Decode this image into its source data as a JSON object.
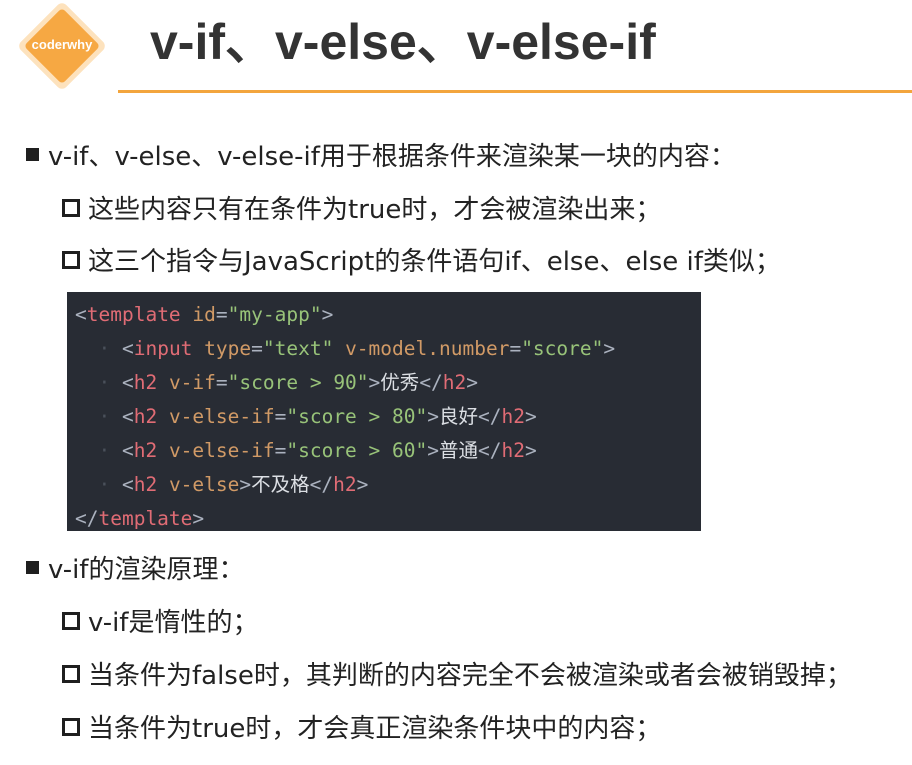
{
  "logo": {
    "text": "coderwhy"
  },
  "title": "v-if、v-else、v-else-if",
  "sections": [
    {
      "heading": "v-if、v-else、v-else-if用于根据条件来渲染某一块的内容：",
      "items": [
        "这些内容只有在条件为true时，才会被渲染出来；",
        "这三个指令与JavaScript的条件语句if、else、else if类似；"
      ]
    },
    {
      "heading": "v-if的渲染原理：",
      "items": [
        "v-if是惰性的；",
        "当条件为false时，其判断的内容完全不会被渲染或者会被销毁掉；",
        "当条件为true时，才会真正渲染条件块中的内容；"
      ]
    }
  ],
  "code": {
    "l1": {
      "open": "<",
      "tag": "template",
      "attr": " id",
      "eq": "=",
      "val": "\"my-app\"",
      "close": ">"
    },
    "l2": {
      "indent": "  · ",
      "open": "<",
      "tag": "input",
      "attr1": " type",
      "eq1": "=",
      "val1": "\"text\"",
      "attr2": " v-model.number",
      "eq2": "=",
      "val2": "\"score\"",
      "close": ">"
    },
    "l3": {
      "indent": "  · ",
      "open": "<",
      "tag": "h2",
      "attr": " v-if",
      "eq": "=",
      "val": "\"score > 90\"",
      "close": ">",
      "text": "优秀",
      "endopen": "</",
      "endtag": "h2",
      "endclose": ">"
    },
    "l4": {
      "indent": "  · ",
      "open": "<",
      "tag": "h2",
      "attr": " v-else-if",
      "eq": "=",
      "val": "\"score > 80\"",
      "close": ">",
      "text": "良好",
      "endopen": "</",
      "endtag": "h2",
      "endclose": ">"
    },
    "l5": {
      "indent": "  · ",
      "open": "<",
      "tag": "h2",
      "attr": " v-else-if",
      "eq": "=",
      "val": "\"score > 60\"",
      "close": ">",
      "text": "普通",
      "endopen": "</",
      "endtag": "h2",
      "endclose": ">"
    },
    "l6": {
      "indent": "  · ",
      "open": "<",
      "tag": "h2",
      "attr": " v-else",
      "close": ">",
      "text": "不及格",
      "endopen": "</",
      "endtag": "h2",
      "endclose": ">"
    },
    "l7": {
      "open": "</",
      "tag": "template",
      "close": ">"
    }
  }
}
